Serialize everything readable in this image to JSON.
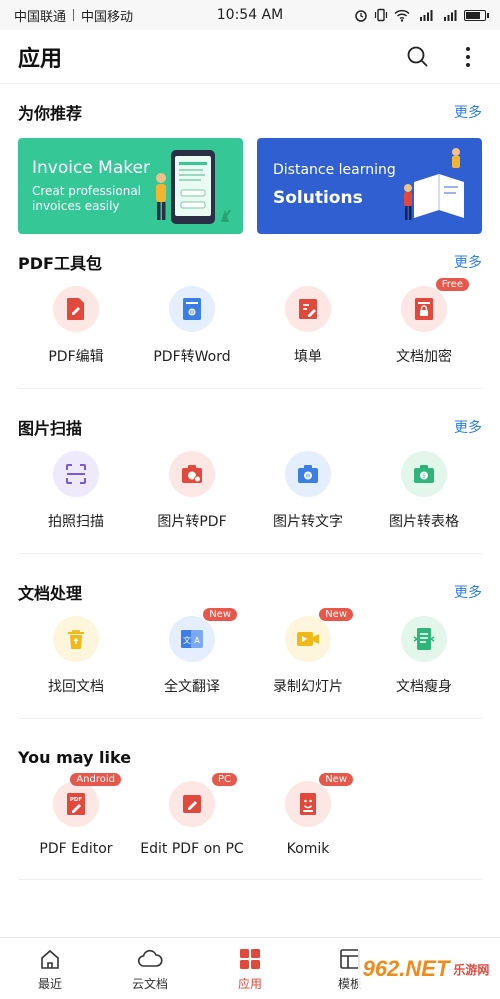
{
  "status_bar": {
    "carrier1": "中国联通",
    "carrier2": "中国移动",
    "time": "10:54 AM",
    "sim1_signal": "4G",
    "sim2_signal": "4G"
  },
  "app_bar": {
    "title": "应用"
  },
  "recommend": {
    "title": "为你推荐",
    "more": "更多",
    "banner1": {
      "title": "Invoice Maker",
      "subtitle": "Creat professional invoices easily"
    },
    "banner2": {
      "line1": "Distance learning",
      "line2": "Solutions"
    }
  },
  "pdf_tools": {
    "title": "PDF工具包",
    "more": "更多",
    "items": [
      {
        "label": "PDF编辑"
      },
      {
        "label": "PDF转Word"
      },
      {
        "label": "填单"
      },
      {
        "label": "文档加密",
        "badge": "Free"
      }
    ]
  },
  "scan": {
    "title": "图片扫描",
    "more": "更多",
    "items": [
      {
        "label": "拍照扫描"
      },
      {
        "label": "图片转PDF"
      },
      {
        "label": "图片转文字"
      },
      {
        "label": "图片转表格"
      }
    ]
  },
  "doc_process": {
    "title": "文档处理",
    "more": "更多",
    "items": [
      {
        "label": "找回文档"
      },
      {
        "label": "全文翻译",
        "badge": "New"
      },
      {
        "label": "录制幻灯片",
        "badge": "New"
      },
      {
        "label": "文档瘦身"
      }
    ]
  },
  "you_may_like": {
    "title": "You may like",
    "items": [
      {
        "label": "PDF Editor",
        "badge": "Android"
      },
      {
        "label": "Edit PDF on PC",
        "badge": "PC"
      },
      {
        "label": "Komik",
        "badge": "New"
      }
    ]
  },
  "bottom_nav": {
    "items": [
      {
        "label": "最近"
      },
      {
        "label": "云文档"
      },
      {
        "label": "应用"
      },
      {
        "label": "模板"
      }
    ]
  },
  "watermark": {
    "text": "962.NET",
    "sub": "乐游网"
  },
  "colors": {
    "accent": "#e0493b",
    "link": "#2f7de1",
    "green_banner": "#35c795",
    "blue_banner": "#2f5fd0"
  }
}
